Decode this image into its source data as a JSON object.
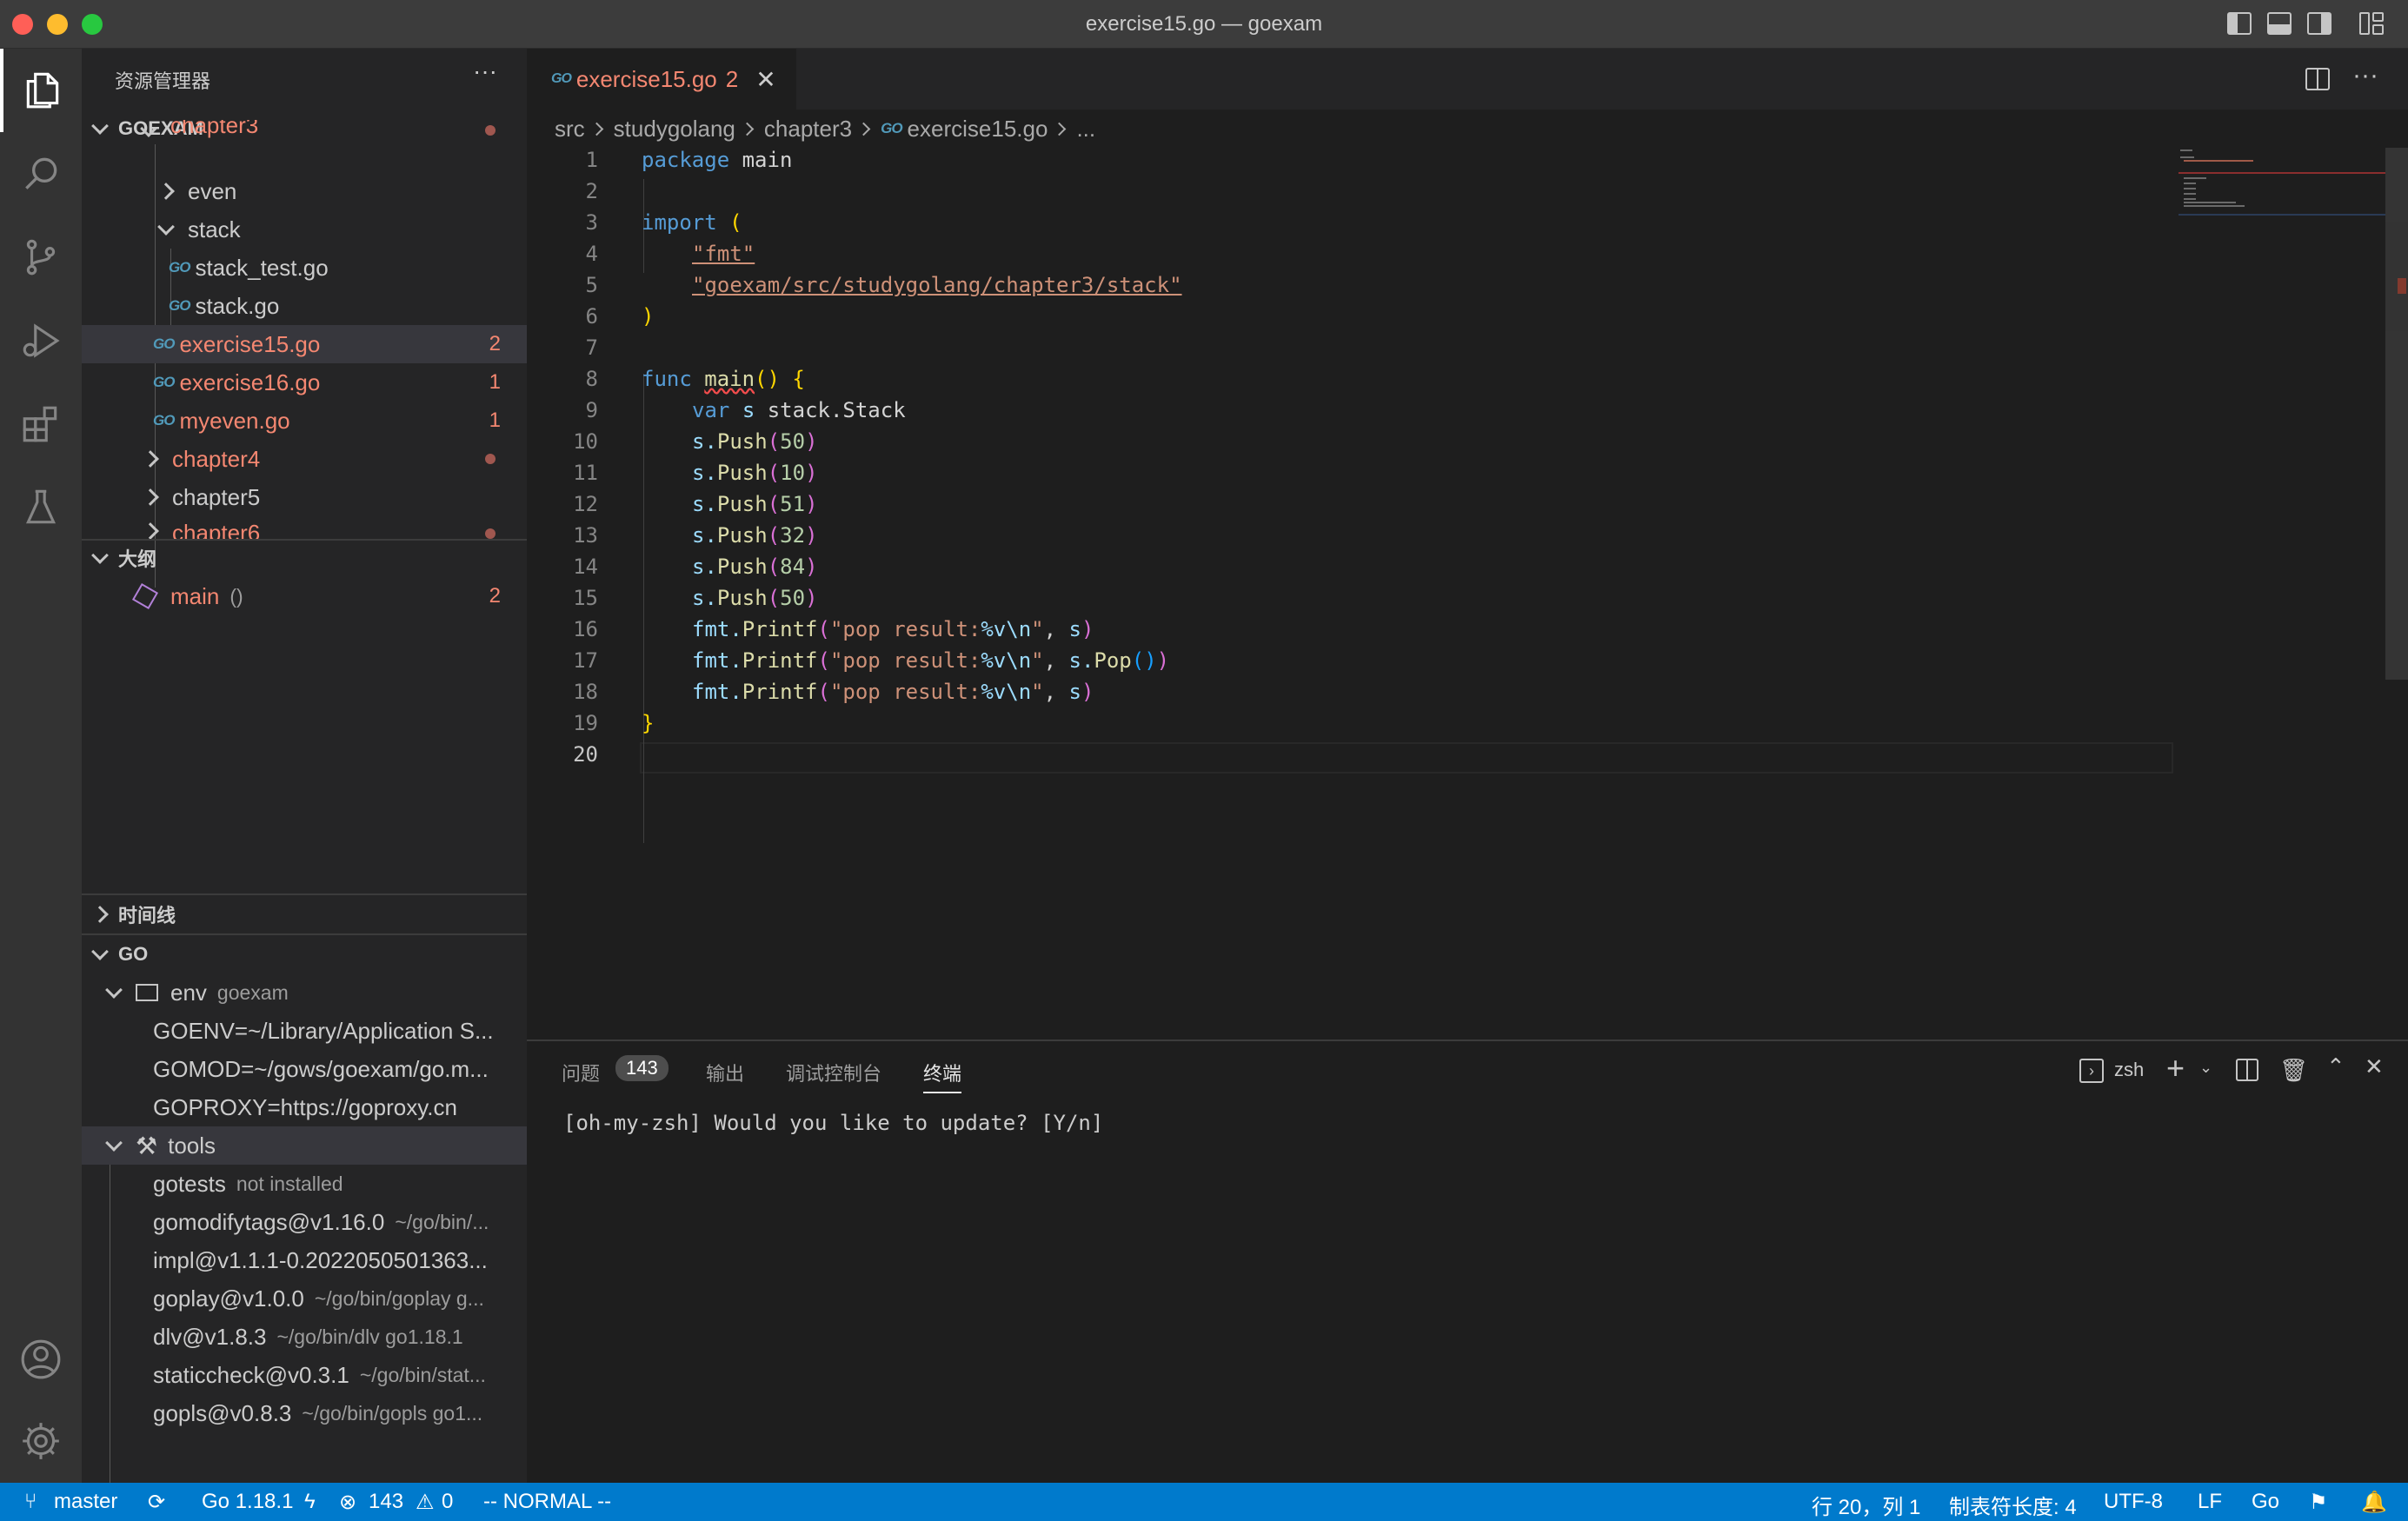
{
  "window": {
    "title": "exercise15.go — goexam"
  },
  "activity_bar": [
    "files-icon",
    "search-icon",
    "source-control-icon",
    "run-debug-icon",
    "extensions-icon",
    "testing-icon",
    "account-icon",
    "settings-gear-icon"
  ],
  "sidebar": {
    "title": "资源管理器",
    "more": "···",
    "root": "GOEXAM",
    "tree": [
      {
        "label": "chapter3",
        "kind": "folder",
        "open": true,
        "error": true
      },
      {
        "label": "even",
        "kind": "folder",
        "open": false
      },
      {
        "label": "stack",
        "kind": "folder",
        "open": true
      },
      {
        "label": "stack_test.go",
        "kind": "go-file"
      },
      {
        "label": "stack.go",
        "kind": "go-file"
      },
      {
        "label": "exercise15.go",
        "kind": "go-file",
        "error": true,
        "count": "2",
        "selected": true
      },
      {
        "label": "exercise16.go",
        "kind": "go-file",
        "error": true,
        "count": "1"
      },
      {
        "label": "myeven.go",
        "kind": "go-file",
        "error": true,
        "count": "1"
      },
      {
        "label": "chapter4",
        "kind": "folder",
        "error": true
      },
      {
        "label": "chapter5",
        "kind": "folder"
      },
      {
        "label": "chapter6",
        "kind": "folder",
        "error": true
      }
    ],
    "outline": {
      "title": "大纲",
      "symbol": "main",
      "signature": "()",
      "count": "2"
    },
    "timeline": {
      "title": "时间线"
    },
    "go": {
      "title": "GO",
      "env": {
        "label": "env",
        "desc": "goexam",
        "items": [
          "GOENV=~/Library/Application S...",
          "GOMOD=~/gows/goexam/go.m...",
          "GOPROXY=https://goproxy.cn"
        ]
      },
      "tools": {
        "label": "tools",
        "items": [
          {
            "name": "gotests",
            "desc": "not installed"
          },
          {
            "name": "gomodifytags@v1.16.0",
            "desc": "~/go/bin/..."
          },
          {
            "name": "impl@v1.1.1-0.2022050501363...",
            "desc": ""
          },
          {
            "name": "goplay@v1.0.0",
            "desc": "~/go/bin/goplay g..."
          },
          {
            "name": "dlv@v1.8.3",
            "desc": "~/go/bin/dlv go1.18.1"
          },
          {
            "name": "staticcheck@v0.3.1",
            "desc": "~/go/bin/stat..."
          },
          {
            "name": "gopls@v0.8.3",
            "desc": "~/go/bin/gopls go1..."
          }
        ]
      }
    }
  },
  "editor": {
    "tab": {
      "label": "exercise15.go",
      "count": "2",
      "close": "✕",
      "icon": "GO"
    },
    "breadcrumb": [
      "src",
      "studygolang",
      "chapter3",
      "exercise15.go",
      "..."
    ],
    "active_line": "20",
    "lines": [
      "1",
      "2",
      "3",
      "4",
      "5",
      "6",
      "7",
      "8",
      "9",
      "10",
      "11",
      "12",
      "13",
      "14",
      "15",
      "16",
      "17",
      "18",
      "19",
      "20"
    ],
    "code": {
      "l1_kw": "package",
      "l1_rest": " main",
      "l3_kw": "import",
      "l3_paren": "(",
      "l4": "\"fmt\"",
      "l5": "\"goexam/src/studygolang/chapter3/stack\"",
      "l6": ")",
      "l8_kw": "func",
      "l8_fn": "main",
      "l8_rest": "()",
      "l8_brace": "{",
      "l9_kw": "var",
      "l9_var": "s",
      "l9_rest": " stack.Stack",
      "push_obj": "s.",
      "push_fn": "Push",
      "push_vals": [
        "50",
        "10",
        "51",
        "32",
        "84",
        "50"
      ],
      "printf_obj": "fmt.",
      "printf_fn": "Printf",
      "printf_str1": "\"pop result:",
      "printf_fmt": "%v\\n",
      "printf_str2": "\"",
      "printf_arg_s": "s",
      "pop_fn": "Pop",
      "l19": "}"
    }
  },
  "panel": {
    "tabs": [
      "问题",
      "输出",
      "调试控制台",
      "终端"
    ],
    "active_tab": "终端",
    "problems_count": "143",
    "shell": "zsh",
    "terminal_text": "[oh-my-zsh] Would you like to update? [Y/n]"
  },
  "statusbar": {
    "branch": "master",
    "go_version": "Go 1.18.1",
    "errors": "143",
    "warnings": "0",
    "mode": "-- NORMAL --",
    "position": "行 20，列 1",
    "tab_size": "制表符长度: 4",
    "encoding": "UTF-8",
    "eol": "LF",
    "language": "Go"
  },
  "colors": {
    "accent": "#007acc",
    "error": "#f48771",
    "background": "#1e1e1e"
  }
}
